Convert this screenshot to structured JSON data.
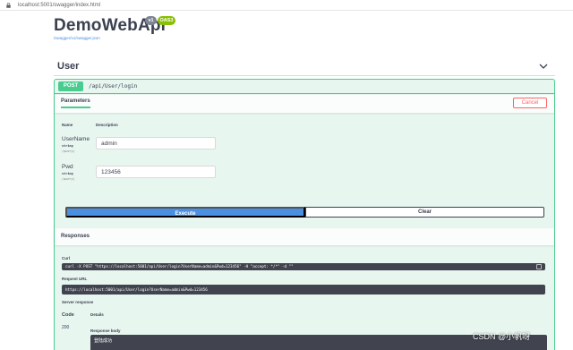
{
  "browser": {
    "url": "localhost:5001/swagger/index.html"
  },
  "header": {
    "title": "DemoWebApi",
    "version_badge": "v1",
    "oas_badge": "OAS3",
    "spec_link": "/swagger/v1/swagger.json"
  },
  "tag": {
    "name": "User"
  },
  "operation": {
    "method": "POST",
    "path": "/api/User/login"
  },
  "parameters": {
    "title": "Parameters",
    "cancel_label": "Cancel",
    "col_name": "Name",
    "col_description": "Description",
    "items": [
      {
        "name": "UserName",
        "type": "string",
        "in": "(query)",
        "value": "admin"
      },
      {
        "name": "Pwd",
        "type": "string",
        "in": "(query)",
        "value": "123456"
      }
    ],
    "execute_label": "Execute",
    "clear_label": "Clear"
  },
  "responses": {
    "title": "Responses",
    "curl_label": "Curl",
    "curl_value": "curl -X POST \"https://localhost:5001/api/User/login?UserName=admin&Pwd=123456\" -H  \"accept: */*\" -d \"\"",
    "request_url_label": "Request URL",
    "request_url_value": "https://localhost:5001/api/User/login?UserName=admin&Pwd=123456",
    "server_response_label": "Server response",
    "code_label": "Code",
    "details_label": "Details",
    "code_value": "200",
    "response_body_label": "Response body",
    "response_body_value": "登陆成功"
  },
  "watermark": "CSDN @小帆呀",
  "colors": {
    "post_green": "#49cc90",
    "post_bg": "#e8f6f0",
    "execute_blue": "#4990e2",
    "cancel_red": "#ff6060",
    "code_bg": "#41444e",
    "oas_green": "#89bf04"
  }
}
